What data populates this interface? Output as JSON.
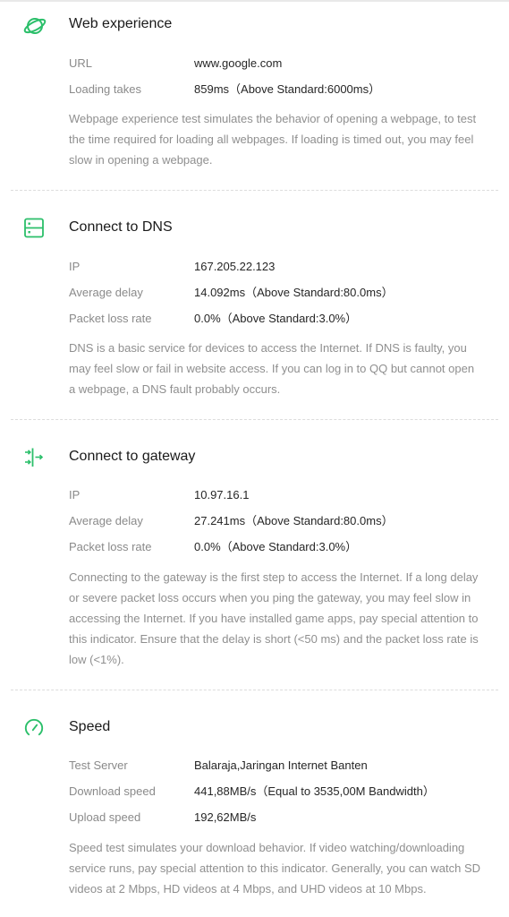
{
  "accent_color": "#2bbf6a",
  "sections": [
    {
      "icon": "planet-icon",
      "title": "Web experience",
      "rows": [
        {
          "label": "URL",
          "value": "www.google.com"
        },
        {
          "label": "Loading takes",
          "value": "859ms（Above Standard:6000ms）"
        }
      ],
      "description": "Webpage experience test simulates the behavior of opening a webpage, to test the time required for loading all webpages. If loading is timed out, you may feel slow in opening a webpage."
    },
    {
      "icon": "server-icon",
      "title": "Connect to DNS",
      "rows": [
        {
          "label": "IP",
          "value": "167.205.22.123"
        },
        {
          "label": "Average delay",
          "value": "14.092ms（Above Standard:80.0ms）"
        },
        {
          "label": "Packet loss rate",
          "value": "0.0%（Above Standard:3.0%）"
        }
      ],
      "description": "DNS is a basic service for devices to access the Internet. If DNS is faulty, you may feel slow or fail in website access. If you can log in to QQ but cannot open a webpage, a DNS fault probably occurs."
    },
    {
      "icon": "gateway-arrows-icon",
      "title": "Connect to gateway",
      "rows": [
        {
          "label": "IP",
          "value": "10.97.16.1"
        },
        {
          "label": "Average delay",
          "value": "27.241ms（Above Standard:80.0ms）"
        },
        {
          "label": "Packet loss rate",
          "value": "0.0%（Above Standard:3.0%）"
        }
      ],
      "description": "Connecting to the gateway is the first step to access the Internet. If a long delay or severe packet loss occurs when you ping the gateway, you may feel slow in accessing the Internet. If you have installed game apps, pay special attention to this indicator. Ensure that the delay is short (<50 ms) and the packet loss rate is low (<1%)."
    },
    {
      "icon": "speedometer-icon",
      "title": "Speed",
      "rows": [
        {
          "label": "Test Server",
          "value": "Balaraja,Jaringan Internet Banten"
        },
        {
          "label": "Download speed",
          "value": "441,88MB/s（Equal to 3535,00M Bandwidth）"
        },
        {
          "label": "Upload speed",
          "value": "192,62MB/s"
        }
      ],
      "description": "Speed test simulates your download behavior. If video watching/downloading service runs, pay special attention to this indicator. Generally, you can watch SD videos at 2 Mbps, HD videos at 4 Mbps, and UHD videos at 10 Mbps."
    }
  ]
}
